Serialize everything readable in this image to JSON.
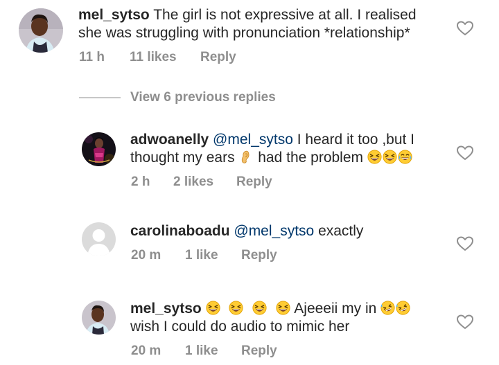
{
  "comments": [
    {
      "username": "mel_sytso",
      "line1": " The girl is not expressive at all. I realised",
      "line2": "she was struggling with pronunciation *relationship*",
      "time": "11 h",
      "likes": "11 likes",
      "reply": "Reply"
    },
    {
      "username": "adwoanelly",
      "mention": "@mel_sytso",
      "line1": " I heard it too ,but I",
      "line2a": "thought my ears ",
      "line2b": " had the problem ",
      "time": "2 h",
      "likes": "2 likes",
      "reply": "Reply"
    },
    {
      "username": "carolinaboadu",
      "mention": "@mel_sytso",
      "line1": " exactly",
      "time": "20 m",
      "likes": "1 like",
      "reply": "Reply"
    },
    {
      "username": "mel_sytso",
      "line1": " Ajeeeii my in ",
      "line2": "wish I could do audio to mimic her",
      "time": "20 m",
      "likes": "1 like",
      "reply": "Reply"
    }
  ],
  "view_replies": "View 6 previous replies",
  "icons": {
    "heart": "heart-outline-icon",
    "laugh": "grinning-squinting-emoji",
    "tears": "face-with-tears-of-joy-emoji",
    "rofl": "rolling-on-floor-laughing-emoji",
    "ear": "ear-emoji"
  },
  "colors": {
    "text": "#262626",
    "meta": "#8e8e8e",
    "mention": "#00376b"
  }
}
